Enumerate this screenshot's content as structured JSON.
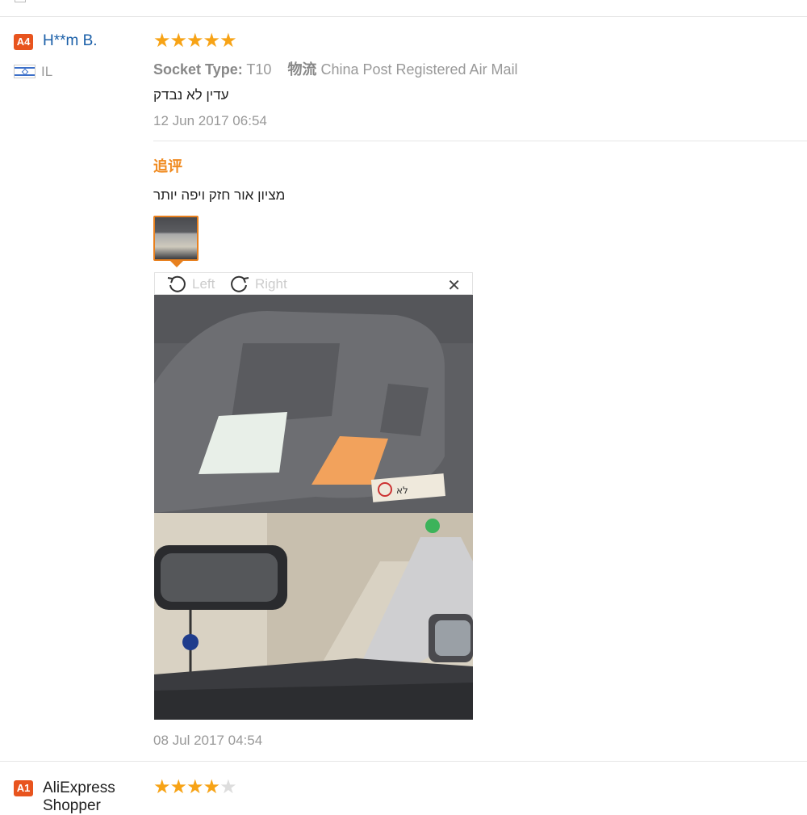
{
  "reviews": [
    {
      "badge": "A4",
      "name": "H**m B.",
      "country": "IL",
      "rating": 5,
      "socket_label": "Socket Type:",
      "socket_value": "T10",
      "shipping_label": "物流",
      "shipping_value": "China Post Registered Air Mail",
      "text": "עדין לא נבדק",
      "date": "12 Jun 2017 06:54",
      "followup_label": "追评",
      "followup_text": "מציון אור חזק ויפה יותר",
      "followup_date": "08 Jul 2017 04:54"
    },
    {
      "badge": "A1",
      "name": "AliExpress Shopper",
      "rating": 4
    }
  ],
  "viewer": {
    "rotate_left_label": "Left",
    "rotate_right_label": "Right",
    "close_icon": "close-icon",
    "photo_sticker_text": "לא"
  },
  "colors": {
    "accent": "#f08a1f",
    "badge": "#e8541e",
    "link": "#1a5fa8",
    "star": "#f7a316"
  }
}
